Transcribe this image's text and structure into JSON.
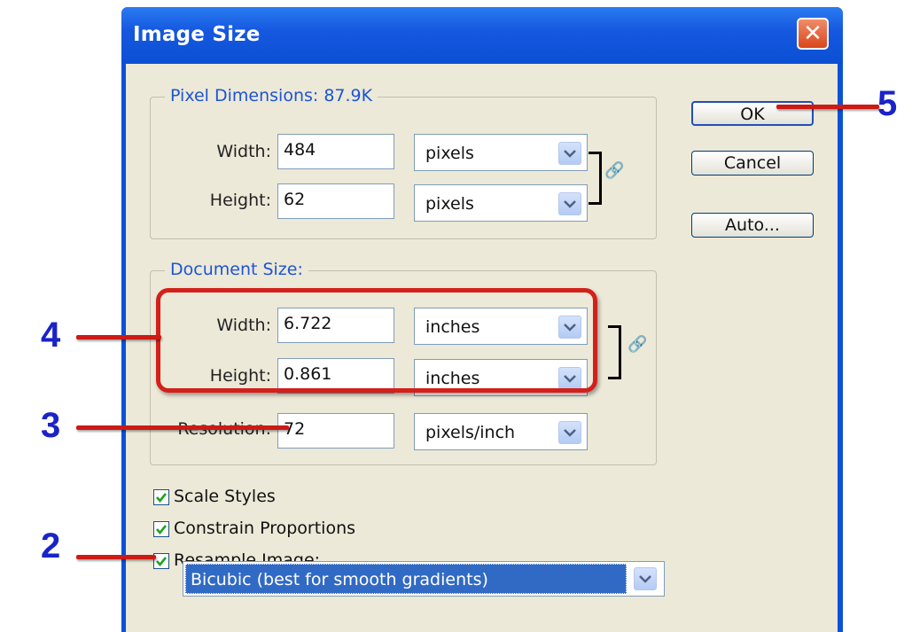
{
  "window": {
    "title": "Image Size"
  },
  "pixel_dimensions": {
    "legend": "Pixel Dimensions:  87.9K",
    "width_label": "Width:",
    "width_value": "484",
    "width_unit": "pixels",
    "height_label": "Height:",
    "height_value": "62",
    "height_unit": "pixels"
  },
  "document_size": {
    "legend": "Document Size:",
    "width_label": "Width:",
    "width_value": "6.722",
    "width_unit": "inches",
    "height_label": "Height:",
    "height_value": "0.861",
    "height_unit": "inches",
    "resolution_label": "Resolution:",
    "resolution_value": "72",
    "resolution_unit": "pixels/inch"
  },
  "buttons": {
    "ok": "OK",
    "cancel": "Cancel",
    "auto": "Auto..."
  },
  "options": {
    "scale_styles": {
      "label": "Scale Styles",
      "checked": true
    },
    "constrain_proportions": {
      "label": "Constrain Proportions",
      "checked": true
    },
    "resample_image": {
      "label": "Resample Image:",
      "checked": true
    },
    "resample_method": "Bicubic (best for smooth gradients)"
  },
  "annotations": [
    "2",
    "3",
    "4",
    "5"
  ],
  "colors": {
    "title_bar": "#0a4fd4",
    "annotation_number": "#1a23c7",
    "annotation_line": "#cc1a14",
    "selection": "#316ac5"
  }
}
